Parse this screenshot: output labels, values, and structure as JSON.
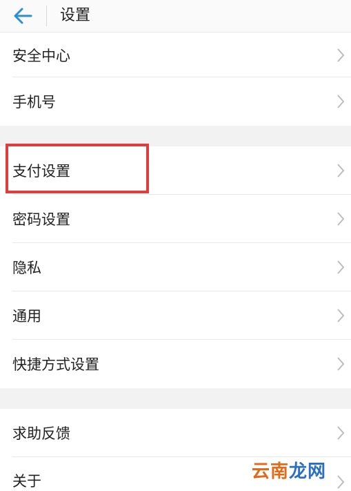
{
  "header": {
    "title": "设置",
    "back_icon": "arrow-left-icon"
  },
  "groups": [
    {
      "items": [
        {
          "label": "安全中心"
        },
        {
          "label": "手机号"
        }
      ]
    },
    {
      "items": [
        {
          "label": "支付设置",
          "highlighted": true
        },
        {
          "label": "密码设置"
        },
        {
          "label": "隐私"
        },
        {
          "label": "通用"
        },
        {
          "label": "快捷方式设置"
        }
      ]
    },
    {
      "items": [
        {
          "label": "求助反馈"
        },
        {
          "label": "关于"
        }
      ]
    }
  ],
  "chevron_icon": "chevron-right-icon",
  "highlight_color": "#e03c3c",
  "accent_color": "#2b8fd6",
  "watermark": {
    "part1": "云南",
    "part2": "龙网",
    "color1": "#e06a1a",
    "color2": "#2a6fc4"
  }
}
